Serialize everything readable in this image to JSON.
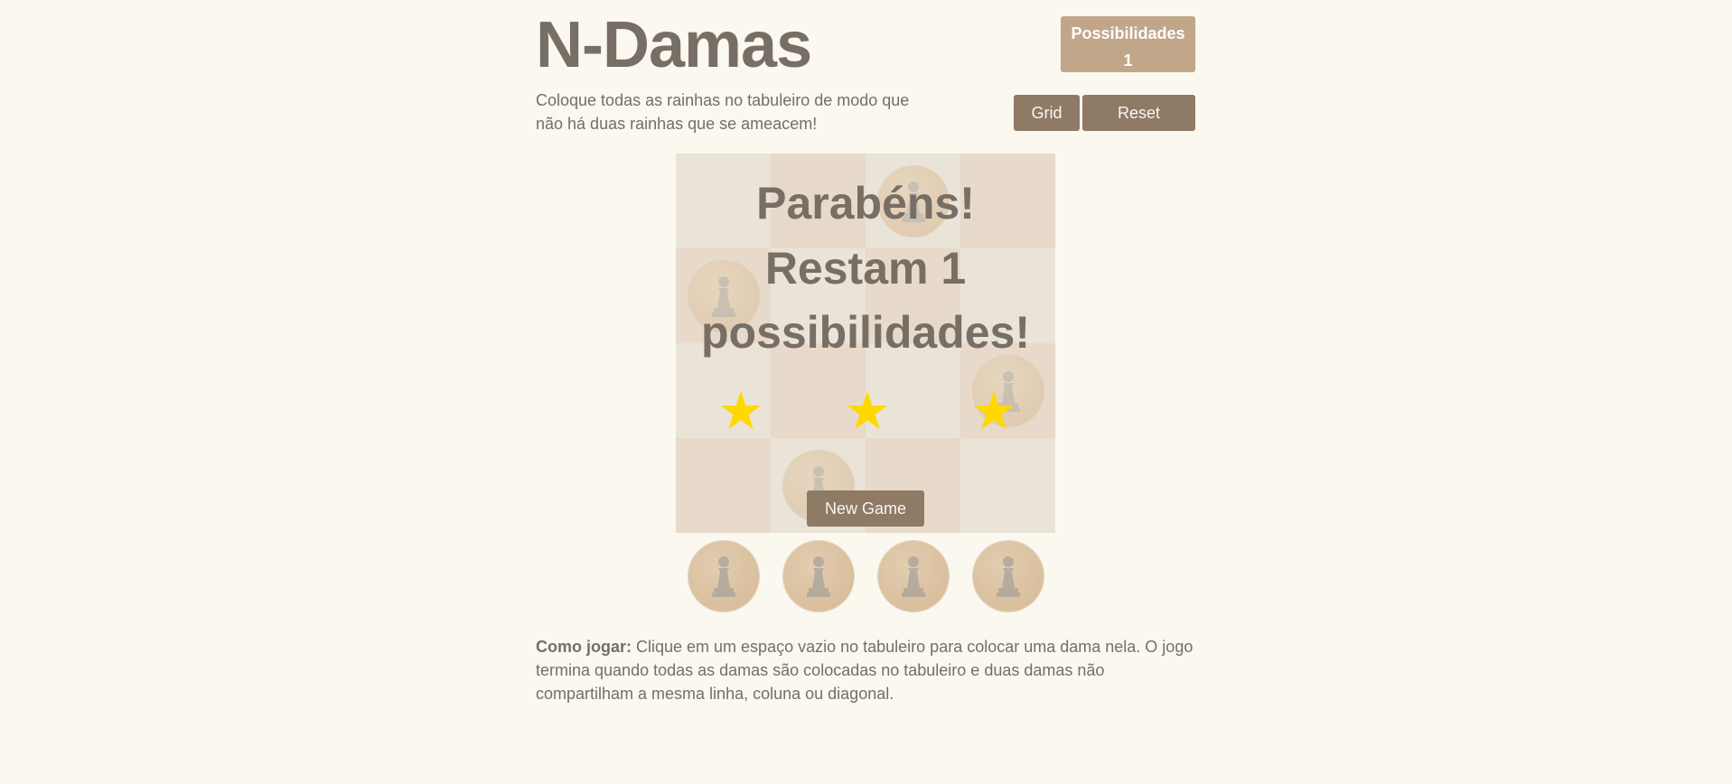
{
  "header": {
    "title": "N-Damas",
    "subtitle": "Coloque todas as rainhas no tabuleiro de modo que não há duas rainhas que se ameacem!"
  },
  "score": {
    "label": "Possibilidades",
    "value": "1"
  },
  "controls": {
    "grid_label": "Grid",
    "reset_label": "Reset"
  },
  "board": {
    "size": 4,
    "queens": [
      [
        0,
        2
      ],
      [
        1,
        0
      ],
      [
        2,
        3
      ],
      [
        3,
        1
      ]
    ],
    "stars_awarded": 3
  },
  "overlay": {
    "line1": "Parabéns!",
    "line2": "Restam 1",
    "line3": "possibilidades!",
    "new_game_label": "New Game"
  },
  "reserve": {
    "count": 4
  },
  "instructions": {
    "bold": "Como jogar:",
    "text": " Clique em um espaço vazio no tabuleiro para colocar uma dama nela. O jogo termina quando todas as damas são colocadas no tabuleiro e duas damas não compartilham a mesma linha, coluna ou diagonal."
  },
  "colors": {
    "background": "#faf8ef",
    "text": "#776e65",
    "button": "#8f7a66",
    "score_box": "#c2a68a",
    "light_cell": "#e8e2d6",
    "dark_cell": "#e4d4c2",
    "star": "#ffd800"
  }
}
